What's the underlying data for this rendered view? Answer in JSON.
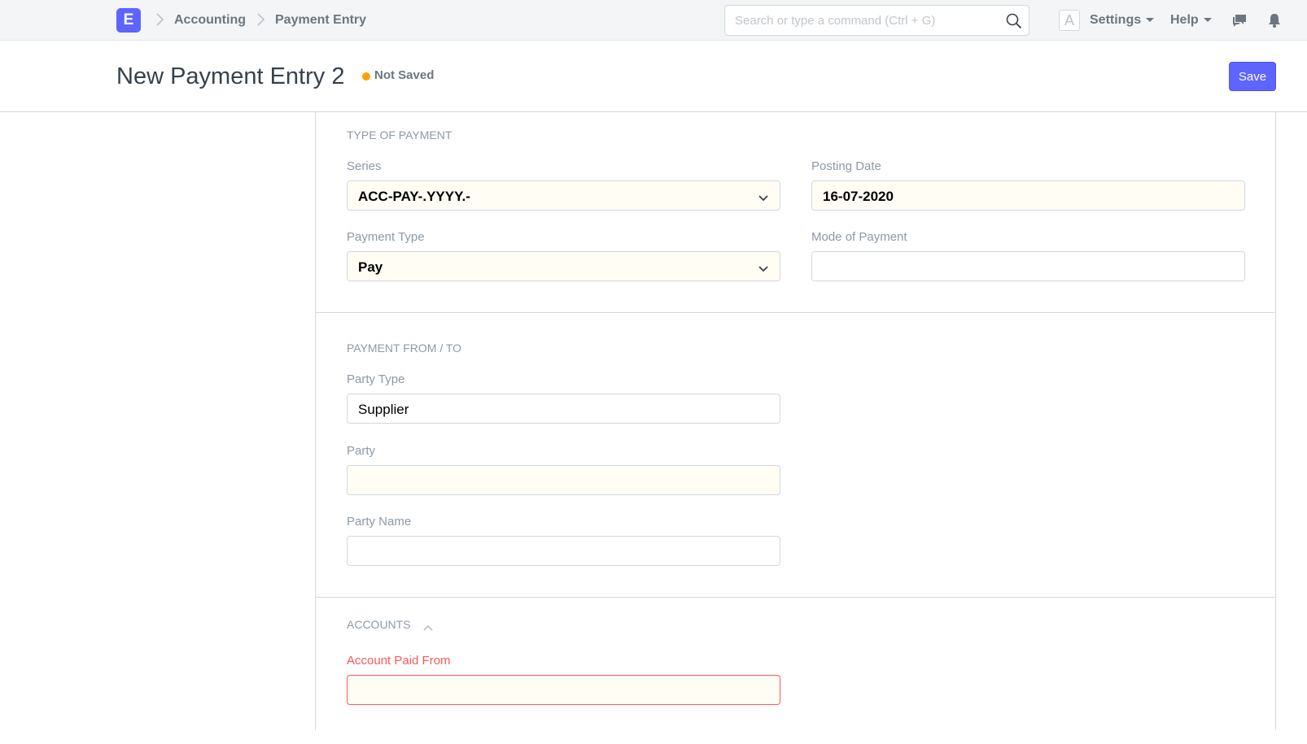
{
  "navbar": {
    "logo_letter": "E",
    "breadcrumbs": [
      "Accounting",
      "Payment Entry"
    ],
    "search_placeholder": "Search or type a command (Ctrl + G)",
    "avatar_letter": "A",
    "settings_label": "Settings",
    "help_label": "Help",
    "icons": [
      "search-icon",
      "chat-icon",
      "bell-icon"
    ]
  },
  "page": {
    "title": "New Payment Entry 2",
    "status": "Not Saved",
    "save_label": "Save",
    "accent_color": "#5e64ff",
    "status_color": "#ffa00a"
  },
  "sections": {
    "type_of_payment": {
      "heading": "TYPE OF PAYMENT",
      "series_label": "Series",
      "series_value": "ACC-PAY-.YYYY.-",
      "posting_date_label": "Posting Date",
      "posting_date_value": "16-07-2020",
      "payment_type_label": "Payment Type",
      "payment_type_value": "Pay",
      "mode_of_payment_label": "Mode of Payment",
      "mode_of_payment_value": ""
    },
    "payment_from_to": {
      "heading": "PAYMENT FROM / TO",
      "party_type_label": "Party Type",
      "party_type_value": "Supplier",
      "party_label": "Party",
      "party_value": "",
      "party_name_label": "Party Name",
      "party_name_value": ""
    },
    "accounts": {
      "heading": "ACCOUNTS",
      "account_paid_from_label": "Account Paid From",
      "account_paid_from_value": "",
      "error_color": "#ff5858"
    }
  }
}
